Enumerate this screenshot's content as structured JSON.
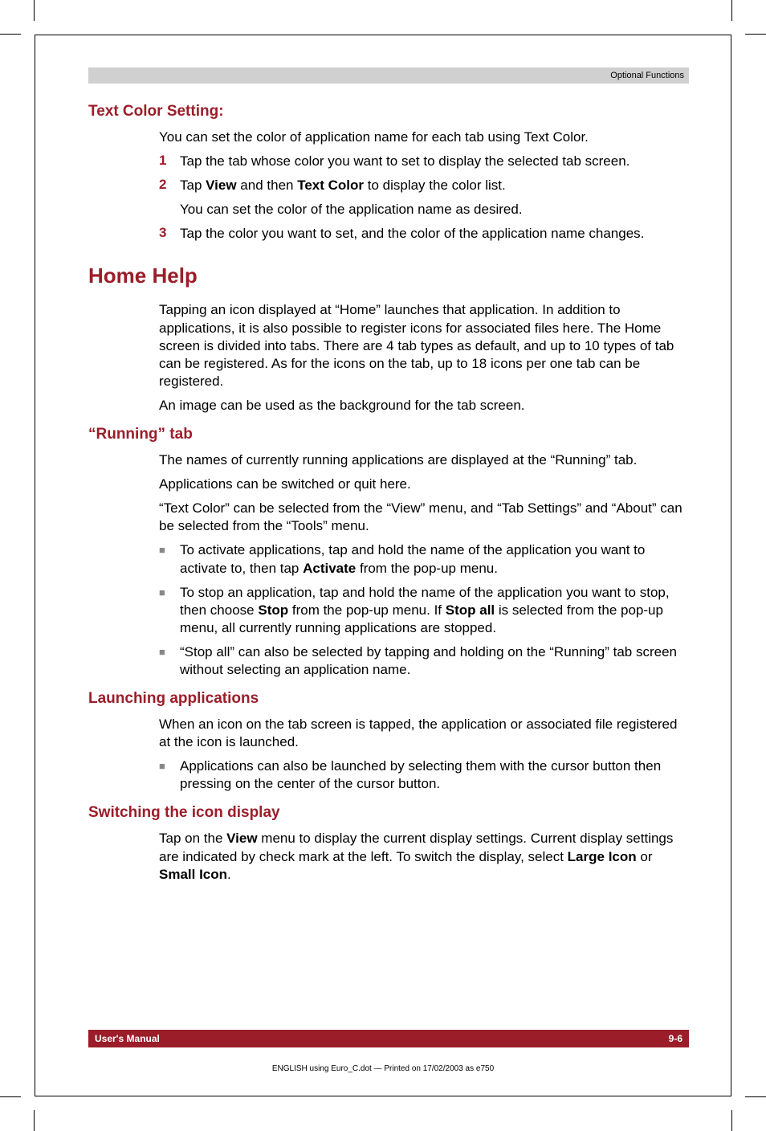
{
  "header": {
    "section_label": "Optional Functions"
  },
  "sections": {
    "text_color": {
      "title": "Text Color Setting:",
      "intro": "You can set the color of application name for each tab using Text Color.",
      "steps": {
        "n1": "1",
        "t1": "Tap the tab whose color you want to set to display the selected tab screen.",
        "n2": "2",
        "t2_a": "Tap ",
        "t2_b": "View",
        "t2_c": " and then ",
        "t2_d": "Text Color",
        "t2_e": " to display the color list.",
        "t2_sub": "You can set the color of the application name as desired.",
        "n3": "3",
        "t3": "Tap the color you want to set, and the color of the application name changes."
      }
    },
    "home_help": {
      "title": "Home Help",
      "p1": "Tapping an icon displayed at “Home” launches that application. In addition to applications, it is also possible to register icons for associated files here. The Home screen is divided into tabs. There are 4 tab types as default, and up to 10 types of tab can be registered. As for the icons on the tab, up to 18 icons per one tab can be registered.",
      "p2": "An image can be used as the background for the tab screen."
    },
    "running_tab": {
      "title": "“Running” tab",
      "p1": "The names of currently running applications are displayed at the “Running” tab.",
      "p2": "Applications can be switched or quit here.",
      "p3": "“Text Color” can be selected from the “View” menu, and “Tab Settings” and “About” can be selected from the “Tools” menu.",
      "b1_a": "To activate applications, tap and hold the name of the application you want to activate to, then tap ",
      "b1_b": "Activate",
      "b1_c": " from the pop-up menu.",
      "b2_a": "To stop an application, tap and hold the name of the application you want to stop, then choose ",
      "b2_b": "Stop",
      "b2_c": " from the pop-up menu. If ",
      "b2_d": "Stop all",
      "b2_e": " is selected from the pop-up menu, all currently running applications are stopped.",
      "b3": "“Stop all” can also be selected by tapping and holding on the “Running” tab screen without selecting an application name."
    },
    "launching": {
      "title": "Launching applications",
      "p1": "When an icon on the tab screen is tapped, the application or associated file registered at the icon is launched.",
      "b1": "Applications can also be launched by selecting them with the cursor button then pressing on the center of the cursor button."
    },
    "switching": {
      "title": "Switching the icon display",
      "p1_a": "Tap on the ",
      "p1_b": "View",
      "p1_c": " menu to display the current display settings. Current display settings are indicated by check mark at the left. To switch the display, select ",
      "p1_d": "Large Icon",
      "p1_e": " or ",
      "p1_f": "Small Icon",
      "p1_g": "."
    }
  },
  "footer": {
    "left": "User's Manual",
    "right": "9-6",
    "meta": "ENGLISH using Euro_C.dot — Printed on 17/02/2003 as e750"
  }
}
